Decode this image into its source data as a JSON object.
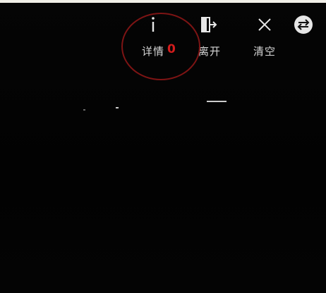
{
  "toolbar": {
    "details": {
      "label": "详情",
      "icon": "info-icon"
    },
    "leave": {
      "label": "离开",
      "icon": "exit-door-icon"
    },
    "clear": {
      "label": "清空",
      "icon": "close-icon"
    },
    "switch": {
      "icon": "swap-arrows-icon"
    }
  },
  "details_badge": "0",
  "colors": {
    "background": "#000000",
    "label_text": "#d6d6d6",
    "badge": "#d41c1c",
    "annotation_circle": "#7d1414"
  }
}
